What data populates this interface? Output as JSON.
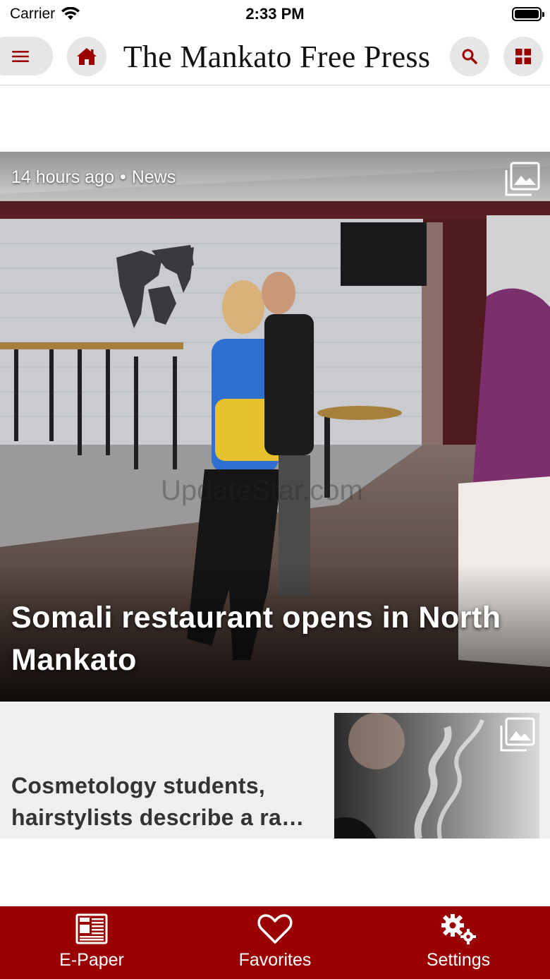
{
  "status_bar": {
    "carrier": "Carrier",
    "time": "2:33 PM",
    "battery_level": 1.0
  },
  "header": {
    "title": "The Mankato Free Press",
    "icons": {
      "menu": "hamburger-menu-icon",
      "home": "home-icon",
      "search": "search-icon",
      "sections": "grid-icon"
    }
  },
  "hero_article": {
    "time_ago": "14 hours ago",
    "separator": "•",
    "category": "News",
    "title": "Somali restaurant opens in North Mankato",
    "watermark": "UpdateStar.com",
    "icon": "photo-gallery-icon"
  },
  "articles": [
    {
      "title": "Cosmetology students, hairstylists describe a ra…",
      "icon": "photo-gallery-icon"
    }
  ],
  "tab_bar": {
    "items": [
      {
        "label": "E-Paper",
        "icon": "newspaper-icon"
      },
      {
        "label": "Favorites",
        "icon": "heart-icon"
      },
      {
        "label": "Settings",
        "icon": "gears-icon"
      }
    ]
  },
  "colors": {
    "brand_red": "#9b0000",
    "button_grey": "#e6e6e6",
    "card_background": "#efefef"
  }
}
